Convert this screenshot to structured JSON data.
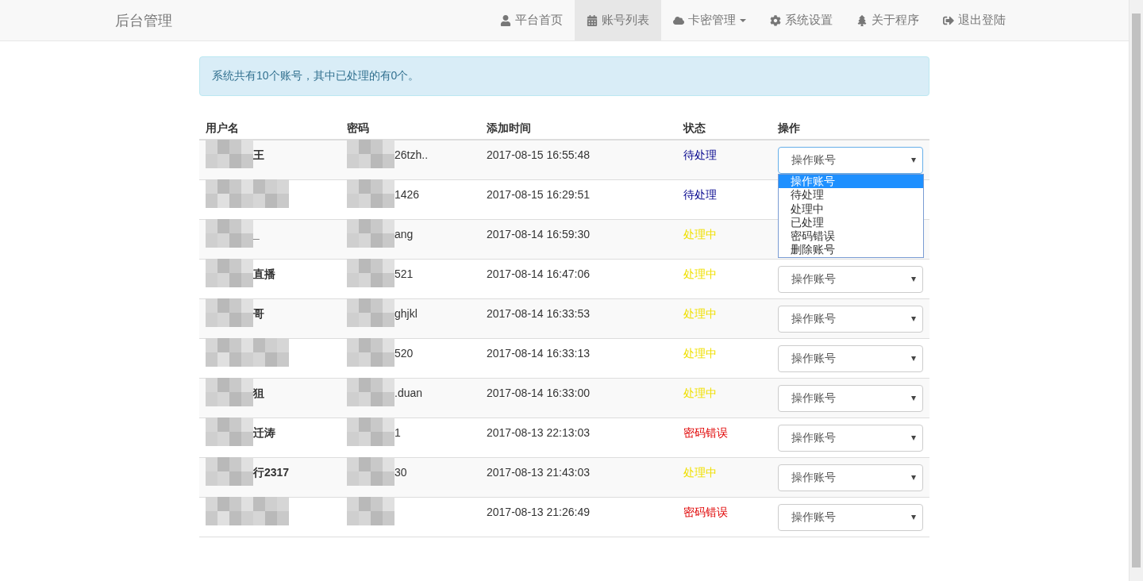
{
  "navbar": {
    "brand": "后台管理",
    "items": [
      {
        "label": "平台首页",
        "selected": false,
        "dropdown": false
      },
      {
        "label": "账号列表",
        "selected": true,
        "dropdown": false
      },
      {
        "label": "卡密管理",
        "selected": false,
        "dropdown": true
      },
      {
        "label": "系统设置",
        "selected": false,
        "dropdown": false
      },
      {
        "label": "关于程序",
        "selected": false,
        "dropdown": false
      },
      {
        "label": "退出登陆",
        "selected": false,
        "dropdown": false
      }
    ]
  },
  "alert": "系统共有10个账号，其中已处理的有0个。",
  "table": {
    "columns": [
      "用户名",
      "密码",
      "添加时间",
      "状态",
      "操作"
    ],
    "rows": [
      {
        "username": "王",
        "password": "26tzh..",
        "time": "2017-08-15 16:55:48",
        "status": "待处理",
        "color": "#00008b",
        "select": {
          "value": "操作账号",
          "open": true,
          "options": [
            {
              "label": "操作账号",
              "selected": true
            },
            {
              "label": "待处理",
              "selected": false
            },
            {
              "label": "处理中",
              "selected": false
            },
            {
              "label": "已处理",
              "selected": false
            },
            {
              "label": "密码错误",
              "selected": false
            },
            {
              "label": "删除账号",
              "selected": false
            }
          ]
        }
      },
      {
        "password": "1426",
        "time": "2017-08-15 16:29:51",
        "status": "待处理",
        "color": "#00008b"
      },
      {
        "username": "_",
        "password": "ang",
        "time": "2017-08-14 16:59:30",
        "status": "处理中",
        "color": "#f0e000"
      },
      {
        "username": "直播",
        "password": "521",
        "time": "2017-08-14 16:47:06",
        "status": "处理中",
        "color": "#f0e000",
        "select": {
          "value": "操作账号",
          "open": false
        }
      },
      {
        "username": "哥",
        "password": "ghjkl",
        "time": "2017-08-14 16:33:53",
        "status": "处理中",
        "color": "#f0e000",
        "select": {
          "value": "操作账号",
          "open": false
        }
      },
      {
        "password": "520",
        "time": "2017-08-14 16:33:13",
        "status": "处理中",
        "color": "#f0e000",
        "select": {
          "value": "操作账号",
          "open": false
        }
      },
      {
        "username": "狙",
        "password": ".duan",
        "time": "2017-08-14 16:33:00",
        "status": "处理中",
        "color": "#f0e000",
        "select": {
          "value": "操作账号",
          "open": false
        }
      },
      {
        "username": "迁涛",
        "password": "1",
        "time": "2017-08-13 22:13:03",
        "status": "密码错误",
        "color": "#e00000",
        "select": {
          "value": "操作账号",
          "open": false
        }
      },
      {
        "username": "行2317",
        "password": "30",
        "time": "2017-08-13 21:43:03",
        "status": "处理中",
        "color": "#f0e000",
        "select": {
          "value": "操作账号",
          "open": false
        }
      },
      {
        "time": "2017-08-13 21:26:49",
        "status": "密码错误",
        "color": "#e00000",
        "select": {
          "value": "操作账号",
          "open": false
        }
      }
    ]
  }
}
